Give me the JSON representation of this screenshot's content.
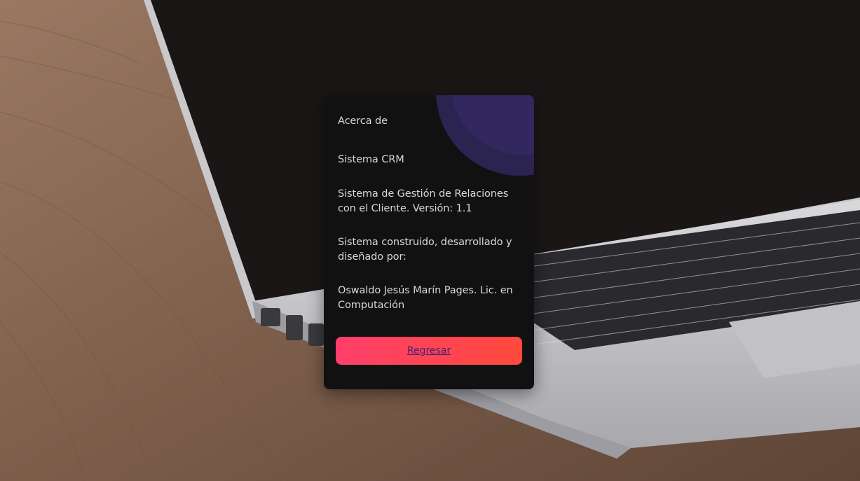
{
  "card": {
    "title": "Acerca de",
    "system_name": "Sistema CRM",
    "description": "Sistema de Gestión de Relaciones con el Cliente. Versión: 1.1",
    "built_by_label": "Sistema construido, desarrollado y diseñado por:",
    "author": "Oswaldo Jesús Marín Pages. Lic. en Computación",
    "back_button_label": "Regresar"
  },
  "colors": {
    "card_background": "#111112",
    "button_gradient_start": "#ff3f6b",
    "button_gradient_end": "#ff4a3c",
    "link_color": "#4a1f7a",
    "decor_circle": "#32275e"
  }
}
